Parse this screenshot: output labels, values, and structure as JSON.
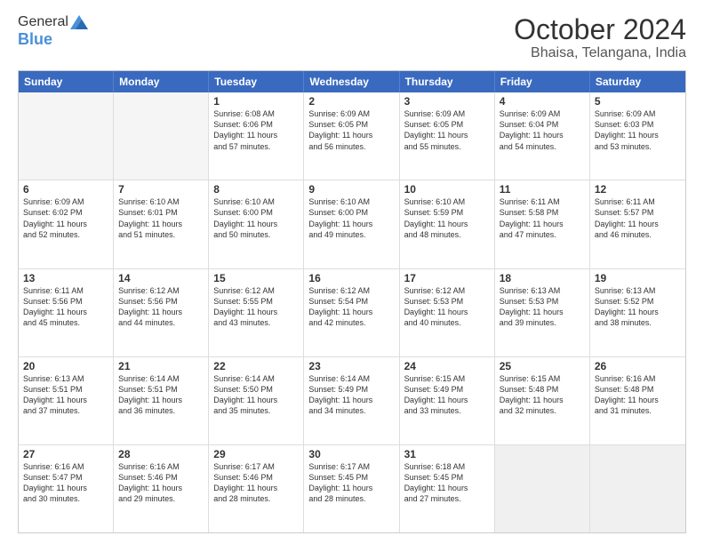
{
  "logo": {
    "general": "General",
    "blue": "Blue"
  },
  "title": "October 2024",
  "subtitle": "Bhaisa, Telangana, India",
  "header_days": [
    "Sunday",
    "Monday",
    "Tuesday",
    "Wednesday",
    "Thursday",
    "Friday",
    "Saturday"
  ],
  "weeks": [
    [
      {
        "day": "",
        "lines": []
      },
      {
        "day": "",
        "lines": []
      },
      {
        "day": "1",
        "lines": [
          "Sunrise: 6:08 AM",
          "Sunset: 6:06 PM",
          "Daylight: 11 hours",
          "and 57 minutes."
        ]
      },
      {
        "day": "2",
        "lines": [
          "Sunrise: 6:09 AM",
          "Sunset: 6:05 PM",
          "Daylight: 11 hours",
          "and 56 minutes."
        ]
      },
      {
        "day": "3",
        "lines": [
          "Sunrise: 6:09 AM",
          "Sunset: 6:05 PM",
          "Daylight: 11 hours",
          "and 55 minutes."
        ]
      },
      {
        "day": "4",
        "lines": [
          "Sunrise: 6:09 AM",
          "Sunset: 6:04 PM",
          "Daylight: 11 hours",
          "and 54 minutes."
        ]
      },
      {
        "day": "5",
        "lines": [
          "Sunrise: 6:09 AM",
          "Sunset: 6:03 PM",
          "Daylight: 11 hours",
          "and 53 minutes."
        ]
      }
    ],
    [
      {
        "day": "6",
        "lines": [
          "Sunrise: 6:09 AM",
          "Sunset: 6:02 PM",
          "Daylight: 11 hours",
          "and 52 minutes."
        ]
      },
      {
        "day": "7",
        "lines": [
          "Sunrise: 6:10 AM",
          "Sunset: 6:01 PM",
          "Daylight: 11 hours",
          "and 51 minutes."
        ]
      },
      {
        "day": "8",
        "lines": [
          "Sunrise: 6:10 AM",
          "Sunset: 6:00 PM",
          "Daylight: 11 hours",
          "and 50 minutes."
        ]
      },
      {
        "day": "9",
        "lines": [
          "Sunrise: 6:10 AM",
          "Sunset: 6:00 PM",
          "Daylight: 11 hours",
          "and 49 minutes."
        ]
      },
      {
        "day": "10",
        "lines": [
          "Sunrise: 6:10 AM",
          "Sunset: 5:59 PM",
          "Daylight: 11 hours",
          "and 48 minutes."
        ]
      },
      {
        "day": "11",
        "lines": [
          "Sunrise: 6:11 AM",
          "Sunset: 5:58 PM",
          "Daylight: 11 hours",
          "and 47 minutes."
        ]
      },
      {
        "day": "12",
        "lines": [
          "Sunrise: 6:11 AM",
          "Sunset: 5:57 PM",
          "Daylight: 11 hours",
          "and 46 minutes."
        ]
      }
    ],
    [
      {
        "day": "13",
        "lines": [
          "Sunrise: 6:11 AM",
          "Sunset: 5:56 PM",
          "Daylight: 11 hours",
          "and 45 minutes."
        ]
      },
      {
        "day": "14",
        "lines": [
          "Sunrise: 6:12 AM",
          "Sunset: 5:56 PM",
          "Daylight: 11 hours",
          "and 44 minutes."
        ]
      },
      {
        "day": "15",
        "lines": [
          "Sunrise: 6:12 AM",
          "Sunset: 5:55 PM",
          "Daylight: 11 hours",
          "and 43 minutes."
        ]
      },
      {
        "day": "16",
        "lines": [
          "Sunrise: 6:12 AM",
          "Sunset: 5:54 PM",
          "Daylight: 11 hours",
          "and 42 minutes."
        ]
      },
      {
        "day": "17",
        "lines": [
          "Sunrise: 6:12 AM",
          "Sunset: 5:53 PM",
          "Daylight: 11 hours",
          "and 40 minutes."
        ]
      },
      {
        "day": "18",
        "lines": [
          "Sunrise: 6:13 AM",
          "Sunset: 5:53 PM",
          "Daylight: 11 hours",
          "and 39 minutes."
        ]
      },
      {
        "day": "19",
        "lines": [
          "Sunrise: 6:13 AM",
          "Sunset: 5:52 PM",
          "Daylight: 11 hours",
          "and 38 minutes."
        ]
      }
    ],
    [
      {
        "day": "20",
        "lines": [
          "Sunrise: 6:13 AM",
          "Sunset: 5:51 PM",
          "Daylight: 11 hours",
          "and 37 minutes."
        ]
      },
      {
        "day": "21",
        "lines": [
          "Sunrise: 6:14 AM",
          "Sunset: 5:51 PM",
          "Daylight: 11 hours",
          "and 36 minutes."
        ]
      },
      {
        "day": "22",
        "lines": [
          "Sunrise: 6:14 AM",
          "Sunset: 5:50 PM",
          "Daylight: 11 hours",
          "and 35 minutes."
        ]
      },
      {
        "day": "23",
        "lines": [
          "Sunrise: 6:14 AM",
          "Sunset: 5:49 PM",
          "Daylight: 11 hours",
          "and 34 minutes."
        ]
      },
      {
        "day": "24",
        "lines": [
          "Sunrise: 6:15 AM",
          "Sunset: 5:49 PM",
          "Daylight: 11 hours",
          "and 33 minutes."
        ]
      },
      {
        "day": "25",
        "lines": [
          "Sunrise: 6:15 AM",
          "Sunset: 5:48 PM",
          "Daylight: 11 hours",
          "and 32 minutes."
        ]
      },
      {
        "day": "26",
        "lines": [
          "Sunrise: 6:16 AM",
          "Sunset: 5:48 PM",
          "Daylight: 11 hours",
          "and 31 minutes."
        ]
      }
    ],
    [
      {
        "day": "27",
        "lines": [
          "Sunrise: 6:16 AM",
          "Sunset: 5:47 PM",
          "Daylight: 11 hours",
          "and 30 minutes."
        ]
      },
      {
        "day": "28",
        "lines": [
          "Sunrise: 6:16 AM",
          "Sunset: 5:46 PM",
          "Daylight: 11 hours",
          "and 29 minutes."
        ]
      },
      {
        "day": "29",
        "lines": [
          "Sunrise: 6:17 AM",
          "Sunset: 5:46 PM",
          "Daylight: 11 hours",
          "and 28 minutes."
        ]
      },
      {
        "day": "30",
        "lines": [
          "Sunrise: 6:17 AM",
          "Sunset: 5:45 PM",
          "Daylight: 11 hours",
          "and 28 minutes."
        ]
      },
      {
        "day": "31",
        "lines": [
          "Sunrise: 6:18 AM",
          "Sunset: 5:45 PM",
          "Daylight: 11 hours",
          "and 27 minutes."
        ]
      },
      {
        "day": "",
        "lines": []
      },
      {
        "day": "",
        "lines": []
      }
    ]
  ]
}
